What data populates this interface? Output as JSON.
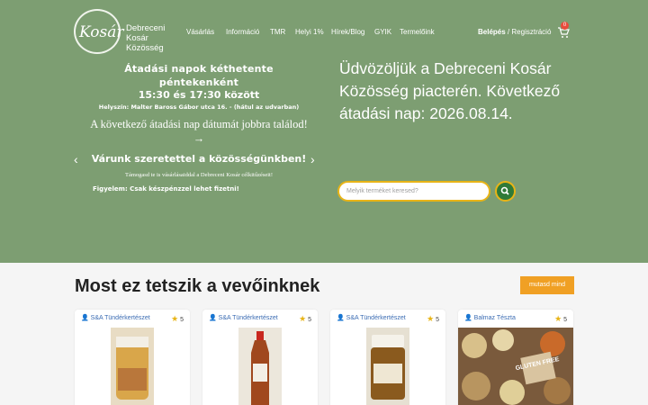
{
  "header": {
    "logo_word": "Kosár",
    "logo_lines": [
      "Debreceni",
      "Kosár",
      "Közösség"
    ],
    "nav": [
      "Vásárlás",
      "Információ",
      "TMR",
      "Helyi 1%",
      "Hírek/Blog",
      "GYIK",
      "Termelőink"
    ],
    "login": "Belépés",
    "separator": "/",
    "register": "Regisztráció",
    "cart_count": "0"
  },
  "slider": {
    "line1": "Átadási napok kéthetente péntekenként",
    "line2": "15:30 és 17:30 között",
    "line3": "Helyszín: Malter Baross Gábor utca 16. - (hátul az udvarban)",
    "line4": "A következő átadási nap dátumát jobbra találod! →",
    "line5": "Várunk szeretettel a közösségünkben!",
    "line6": "Támogasd te is vásárlásaiddal a Debreceni Kosár célkitűzéseit!",
    "line7": "Figyelem: Csak készpénzzel lehet fizetni!"
  },
  "welcome": "Üdvözöljük a Debreceni Kosár Közösség piacterén. Következő átadási nap: 2026.08.14.",
  "search": {
    "placeholder": "Melyik terméket keresed?"
  },
  "section": {
    "title": "Most ez tetszik a vevőinknek",
    "show_all": "mutasd mind"
  },
  "products": [
    {
      "seller": "S&A Tündérkertészet",
      "rating": "5"
    },
    {
      "seller": "S&A Tündérkertészet",
      "rating": "5"
    },
    {
      "seller": "S&A Tündérkertészet",
      "rating": "5"
    },
    {
      "seller": "Balmaz Tészta",
      "rating": "5",
      "image_text": "GLUTEN FREE"
    }
  ],
  "colors": {
    "hero": "#7d9e72",
    "accent": "#e8b417",
    "button": "#f0a024",
    "search_button": "#2f7a38"
  }
}
